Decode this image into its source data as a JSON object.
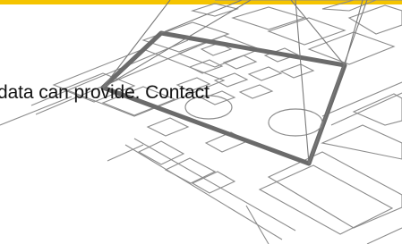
{
  "colors": {
    "accent_bar": "#f5c400",
    "text": "#111111",
    "line_light": "#9a9a9a",
    "line_dark": "#6e6e6e"
  },
  "header": {
    "accent_bar": "yellow-accent-bar"
  },
  "main": {
    "body_text": "data can provide. Contact"
  },
  "illustration": {
    "icon": "map-grid-pyramid-illustration"
  }
}
